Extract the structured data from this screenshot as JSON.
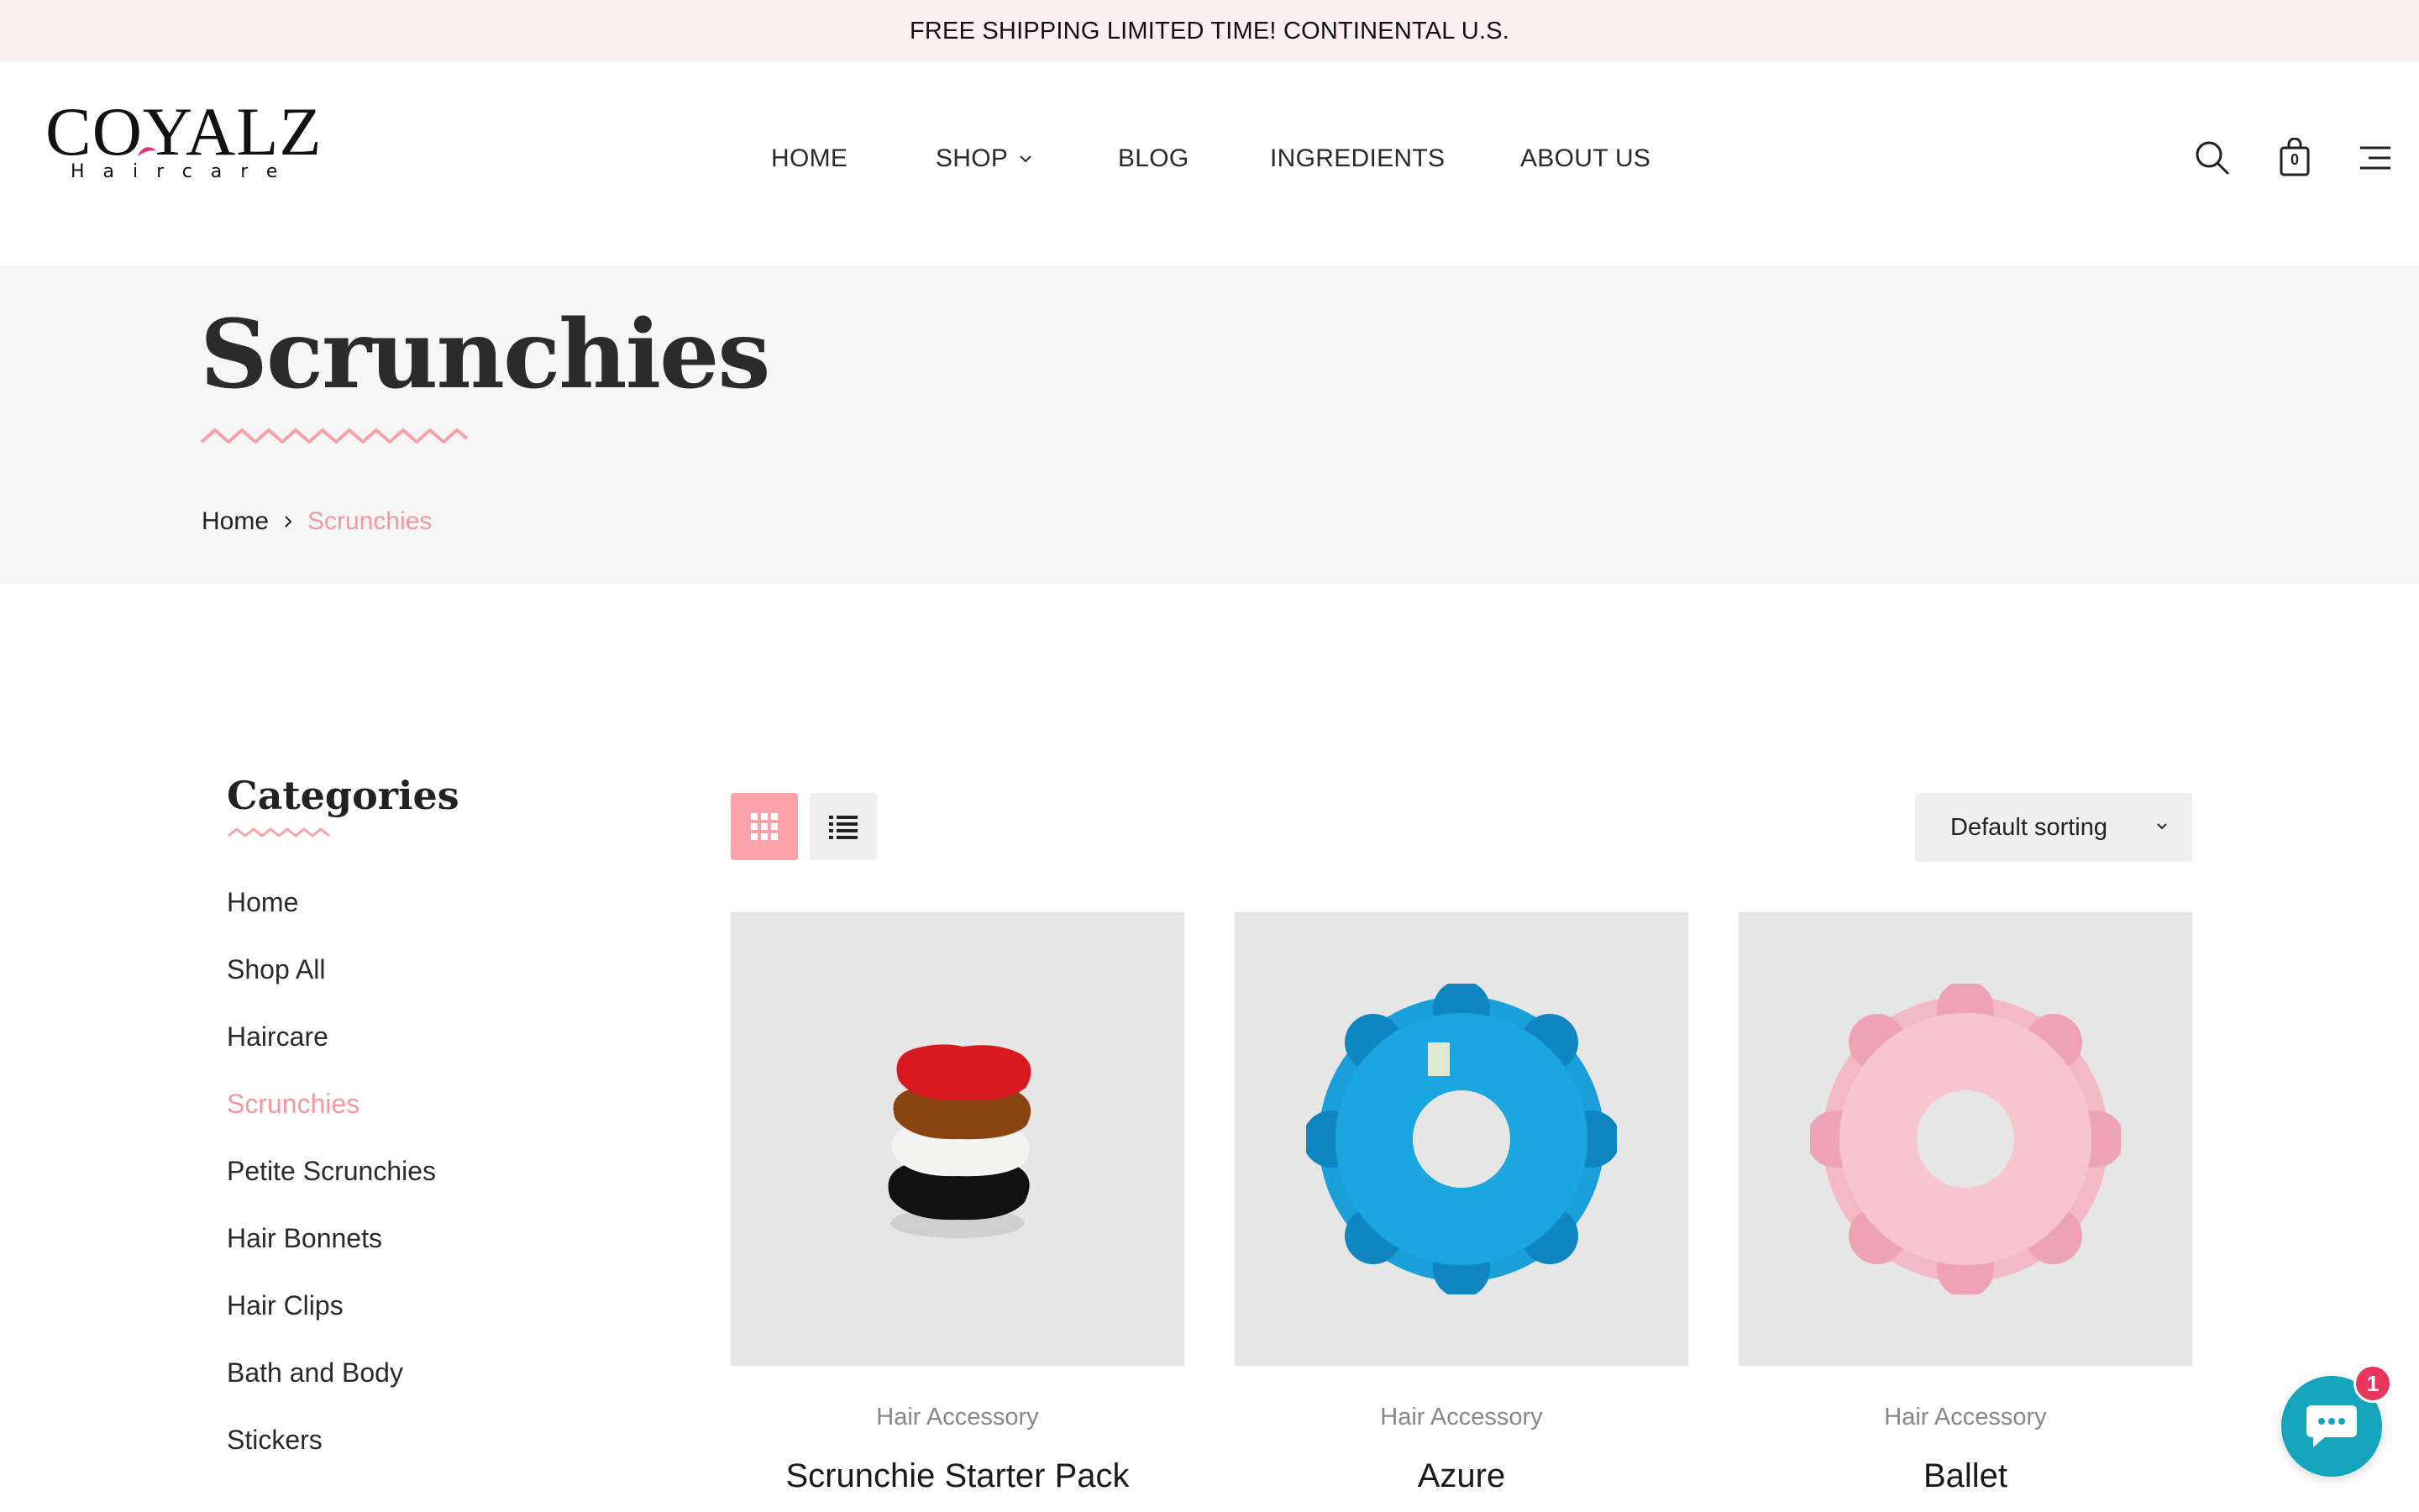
{
  "announcement": "FREE SHIPPING LIMITED TIME! CONTINENTAL U.S.",
  "logo": {
    "word": "COYALZ",
    "sub": "Haircare"
  },
  "nav": {
    "home": "HOME",
    "shop": "SHOP",
    "blog": "BLOG",
    "ingredients": "INGREDIENTS",
    "about": "ABOUT US"
  },
  "header_icons": [
    "search-icon",
    "cart-icon",
    "menu-icon"
  ],
  "cart": {
    "count": "0"
  },
  "hero": {
    "title": "Scrunchies"
  },
  "breadcrumb": {
    "home": "Home",
    "current": "Scrunchies"
  },
  "sidebar": {
    "title": "Categories",
    "items": [
      {
        "label": "Home"
      },
      {
        "label": "Shop All"
      },
      {
        "label": "Haircare"
      },
      {
        "label": "Scrunchies",
        "active": true
      },
      {
        "label": "Petite Scrunchies"
      },
      {
        "label": "Hair Bonnets"
      },
      {
        "label": "Hair Clips"
      },
      {
        "label": "Bath and Body"
      },
      {
        "label": "Stickers"
      }
    ]
  },
  "toolbar": {
    "sort_label": "Default sorting",
    "view": "grid"
  },
  "products": [
    {
      "category": "Hair Accessory",
      "name": "Scrunchie Starter Pack"
    },
    {
      "category": "Hair Accessory",
      "name": "Azure"
    },
    {
      "category": "Hair Accessory",
      "name": "Ballet"
    }
  ],
  "chat": {
    "badge": "1"
  },
  "colors": {
    "accent": "#f3989e",
    "announcement_bg": "#fdf0f3",
    "hero_bg": "#f6f6f6",
    "chat": "#14a5bd",
    "badge": "#e8365d"
  }
}
